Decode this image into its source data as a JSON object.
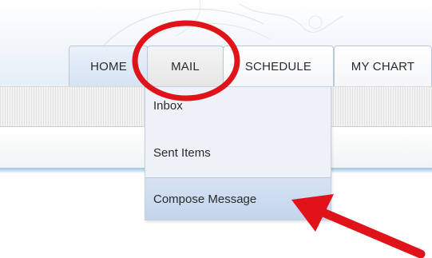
{
  "tabs": [
    {
      "label": "HOME"
    },
    {
      "label": "MAIL"
    },
    {
      "label": "SCHEDULE"
    },
    {
      "label": "MY CHART"
    }
  ],
  "mail_menu": {
    "items": [
      {
        "label": "Inbox"
      },
      {
        "label": "Sent Items"
      },
      {
        "label": "Compose Message"
      }
    ]
  },
  "annotations": {
    "highlight_color": "#e0131a",
    "circle_target": "MAIL",
    "arrow_target": "Compose Message"
  },
  "colors": {
    "tab_border": "#b8c8dc",
    "menu_bg": "#eef2f8",
    "menu_selected_bg": "#c9d9ee",
    "accent_line": "#9cc6e4"
  }
}
